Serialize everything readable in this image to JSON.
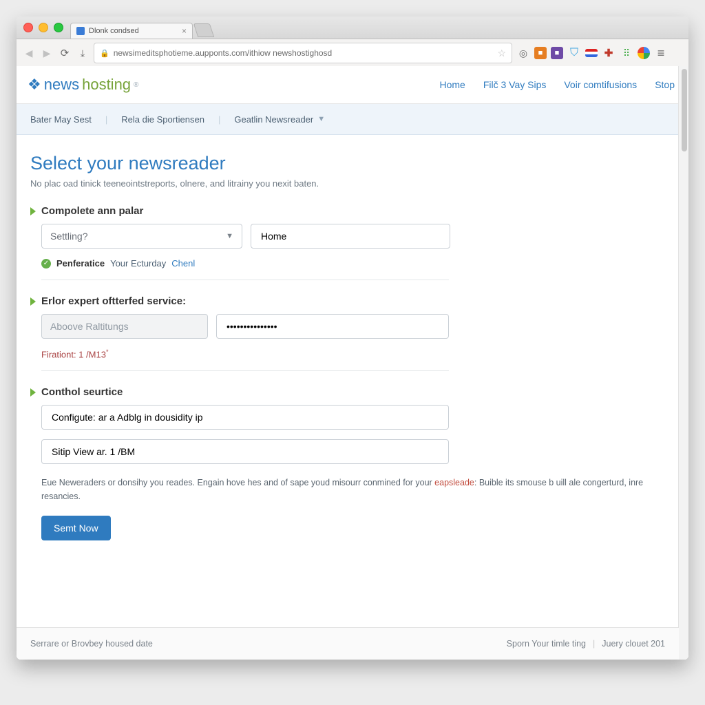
{
  "browser": {
    "tab_title": "Dlonk condsed",
    "url": "newsimeditsphotieme.aupponts.com/ithiow newshostighosd"
  },
  "brand": {
    "part1": "news",
    "part2": "hosting"
  },
  "top_nav": {
    "home": "Home",
    "plans": "Filč 3 Vay Sips",
    "support": "Voir comtifusions",
    "stop": "Stop"
  },
  "sub_bar": {
    "item1": "Bater May Sest",
    "item2": "Rela die Sportiensen",
    "item3": "Geatlin Newsreader"
  },
  "page": {
    "title": "Select your newsreader",
    "subtitle": "No plac oad tinick teeneointstreports, olnere, and litrainy you nexit baten."
  },
  "section1": {
    "title": "Compolete ann palar",
    "select_placeholder": "Settling?",
    "text_value": "Home",
    "helper_bold": "Penferatice",
    "helper_text": "Your Ecturday",
    "helper_link": "Chenl"
  },
  "section2": {
    "title": "Erlor expert oftterfed service:",
    "disabled_value": "Aboove Raltitungs",
    "password_value": "•••••••••••••••",
    "warn_text": "Firationt: 1 /M13"
  },
  "section3": {
    "title": "Conthol seurtice",
    "field1": "Configute: ar a Adblg in dousidity ip",
    "field2": "Sitip View ar. 1 /BM"
  },
  "legal": {
    "pre": "Eue Neweraders or donsihy you reades. Engain hove hes and of sape youd misourr conmined for your ",
    "link": "eapsleade",
    "post": ": Buible its smouse b uill ale congerturd, inre resancies."
  },
  "submit": "Semt Now",
  "footer": {
    "left": "Serrare or Brovbey housed date",
    "right1": "Sporn Your timle ting",
    "right2": "Juery clouet 201"
  }
}
